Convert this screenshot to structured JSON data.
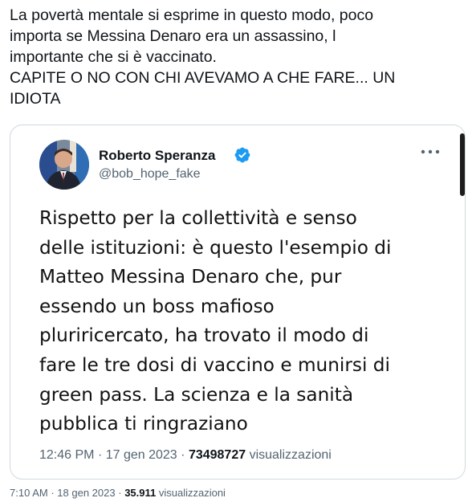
{
  "post": {
    "text_lines": [
      "La povertà mentale si esprime in questo modo, poco",
      "importa se Messina Denaro era un assassino, l",
      "importante che si è vaccinato.",
      "CAPITE O NO CON CHI AVEVAMO A CHE FARE... UN",
      "IDIOTA"
    ],
    "time": "7:10 AM",
    "date": "18 gen 2023",
    "separator": "·",
    "views_count": "35.911",
    "views_label": "visualizzazioni"
  },
  "quoted": {
    "author_name": "Roberto Speranza",
    "author_handle": "@bob_hope_fake",
    "verified": true,
    "icons": {
      "verified": "verified-badge-icon",
      "more": "more-options-icon"
    },
    "colors": {
      "verified_badge": "#1d9bf0"
    },
    "text_lines": [
      "Rispetto per la collettività e senso",
      "delle istituzioni: è questo l'esempio di",
      "Matteo Messina Denaro che, pur",
      "essendo un boss mafioso",
      "pluriricercato, ha trovato il modo di",
      "fare le tre dosi di vaccino e munirsi di",
      "green pass. La scienza e la sanità",
      "pubblica ti ringraziano"
    ],
    "time": "12:46 PM",
    "date": "17 gen 2023",
    "separator": "·",
    "views_count": "73498727",
    "views_label": "visualizzazioni"
  }
}
